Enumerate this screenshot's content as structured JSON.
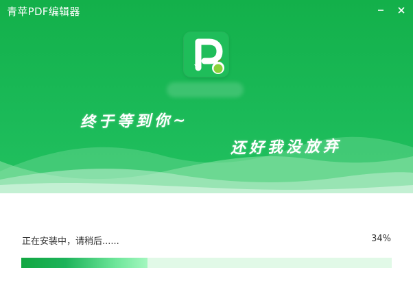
{
  "window": {
    "title": "青苹PDF编辑器",
    "minimize_glyph": "–",
    "close_glyph": "×"
  },
  "banner": {
    "slogan_line1": "终于等到你~",
    "slogan_line2": "还好我没放弃",
    "logo_icon": "pdf-pen-apple-logo"
  },
  "install": {
    "status": "正在安装中，请稍后......",
    "percent_label": "34%",
    "progress": 0.34
  },
  "colors": {
    "banner_green": "#1ab957",
    "progress_start": "#12a742",
    "progress_end": "#a4f7bf",
    "track": "#e1f9e7"
  }
}
